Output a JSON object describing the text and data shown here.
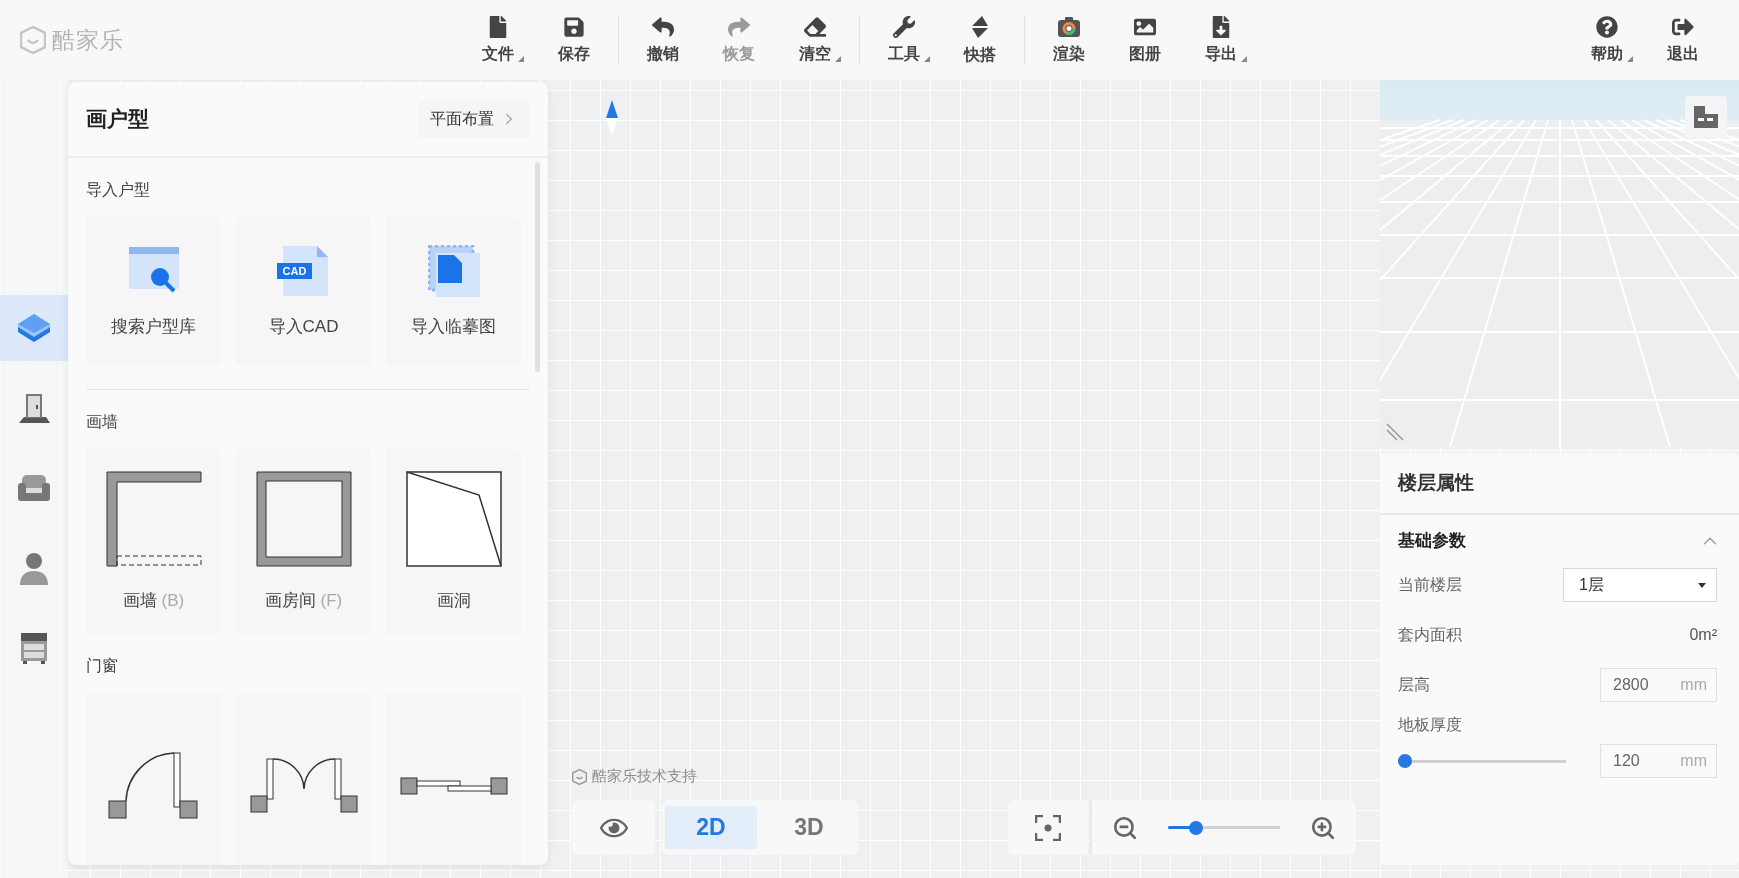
{
  "app": {
    "logo": "酷家乐",
    "watermark": "酷家乐技术支持"
  },
  "toolbar": {
    "groups": [
      [
        {
          "kind": "file",
          "label": "文件",
          "menu": true,
          "disabled": false
        },
        {
          "kind": "save",
          "label": "保存",
          "menu": false,
          "disabled": false
        }
      ],
      [
        {
          "kind": "undo",
          "label": "撤销",
          "menu": false,
          "disabled": false
        },
        {
          "kind": "redo",
          "label": "恢复",
          "menu": false,
          "disabled": true
        },
        {
          "kind": "clear",
          "label": "清空",
          "menu": true,
          "disabled": false
        }
      ],
      [
        {
          "kind": "tools",
          "label": "工具",
          "menu": true,
          "disabled": false
        },
        {
          "kind": "quick",
          "label": "快搭",
          "menu": false,
          "disabled": false
        }
      ],
      [
        {
          "kind": "render",
          "label": "渲染",
          "menu": false,
          "disabled": false
        },
        {
          "kind": "album",
          "label": "图册",
          "menu": false,
          "disabled": false
        },
        {
          "kind": "export",
          "label": "导出",
          "menu": true,
          "disabled": false
        }
      ]
    ],
    "right": [
      {
        "kind": "help",
        "label": "帮助",
        "menu": true,
        "disabled": false
      },
      {
        "kind": "exit",
        "label": "退出",
        "menu": false,
        "disabled": false
      }
    ]
  },
  "rail": [
    {
      "kind": "build",
      "selected": true
    },
    {
      "kind": "door",
      "selected": false
    },
    {
      "kind": "sofa",
      "selected": false
    },
    {
      "kind": "person",
      "selected": false
    },
    {
      "kind": "cabinet",
      "selected": false
    }
  ],
  "panel": {
    "title": "画户型",
    "link": "平面布置",
    "sections": [
      {
        "title": "导入户型",
        "divider": true,
        "items": [
          {
            "kind": "library",
            "label": "搜索户型库"
          },
          {
            "kind": "cad",
            "label": "导入CAD",
            "badge": "CAD"
          },
          {
            "kind": "trace",
            "label": "导入临摹图"
          }
        ]
      },
      {
        "title": "画墙",
        "divider": false,
        "items": [
          {
            "kind": "wall",
            "label": "画墙",
            "shortcut": "(B)"
          },
          {
            "kind": "room",
            "label": "画房间",
            "shortcut": "(F)"
          },
          {
            "kind": "hole",
            "label": "画洞"
          }
        ]
      },
      {
        "title": "门窗",
        "divider": false,
        "items": [
          {
            "kind": "door"
          },
          {
            "kind": "doubledoor"
          },
          {
            "kind": "window"
          }
        ]
      }
    ]
  },
  "view": {
    "modes": [
      {
        "label": "2D",
        "selected": true
      },
      {
        "label": "3D",
        "selected": false
      }
    ],
    "zoom": {
      "level": 0.21
    }
  },
  "properties": {
    "title": "楼层属性",
    "section": {
      "title": "基础参数",
      "expanded": true,
      "rows": [
        {
          "kind": "select",
          "label": "当前楼层",
          "value": "1层"
        },
        {
          "kind": "text",
          "label": "套内面积",
          "value": "0m²"
        },
        {
          "kind": "number",
          "label": "层高",
          "value": "2800",
          "unit": "mm"
        },
        {
          "kind": "slider",
          "label": "地板厚度",
          "level": 0,
          "value": "120",
          "unit": "mm"
        }
      ]
    }
  }
}
